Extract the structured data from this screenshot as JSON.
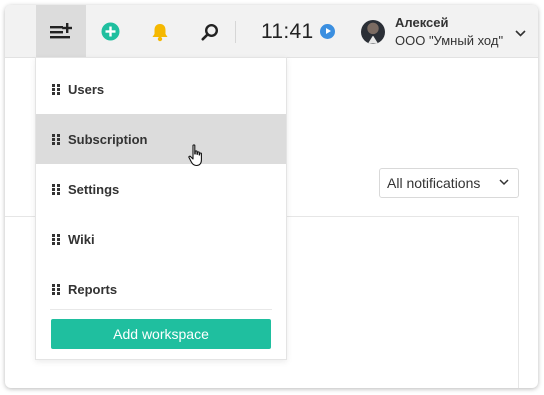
{
  "topbar": {
    "time": "11:41",
    "user": {
      "name": "Алексей",
      "org": "ООО \"Умный ход\""
    },
    "colors": {
      "add": "#1fbf9f",
      "bell": "#f5b800",
      "clock_play": "#3b8fe0"
    }
  },
  "notifications_filter": {
    "selected": "All notifications"
  },
  "dropdown": {
    "items": [
      {
        "label": "Users",
        "active": false
      },
      {
        "label": "Subscription",
        "active": true
      },
      {
        "label": "Settings",
        "active": false
      },
      {
        "label": "Wiki",
        "active": false
      },
      {
        "label": "Reports",
        "active": false
      }
    ],
    "add_workspace_label": "Add workspace"
  }
}
